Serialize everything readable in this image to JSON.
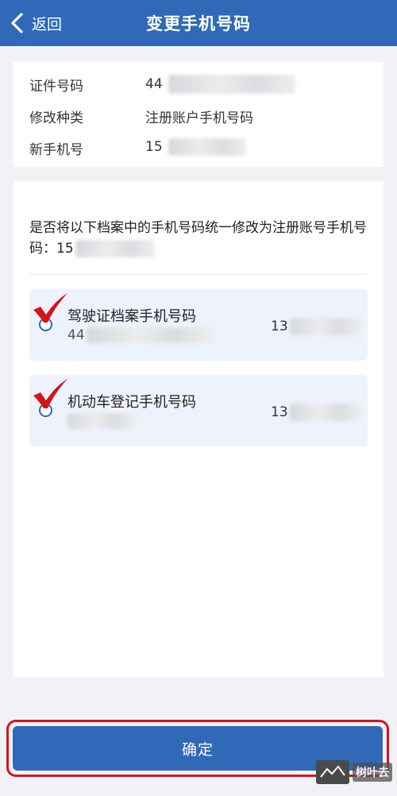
{
  "header": {
    "back_label": "返回",
    "title": "变更手机号码"
  },
  "info": {
    "rows": [
      {
        "label": "证件号码",
        "value": "44"
      },
      {
        "label": "修改种类",
        "value": "注册账户手机号码"
      },
      {
        "label": "新手机号",
        "value": "15"
      }
    ]
  },
  "sync": {
    "prompt": "是否将以下档案中的手机号码统一修改为注册账号手机号码：15",
    "records": [
      {
        "title": "驾驶证档案手机号码",
        "id": "44",
        "phone": "13",
        "checked": true
      },
      {
        "title": "机动车登记手机号码",
        "id": "",
        "phone": "13",
        "checked": true
      }
    ]
  },
  "footer": {
    "confirm_label": "确定"
  },
  "watermark": {
    "text": "树叶去"
  },
  "colors": {
    "primary": "#2f69b7",
    "highlight_border": "#d2151c",
    "checkmark": "#d2151c",
    "record_bg": "#eef2fc"
  }
}
